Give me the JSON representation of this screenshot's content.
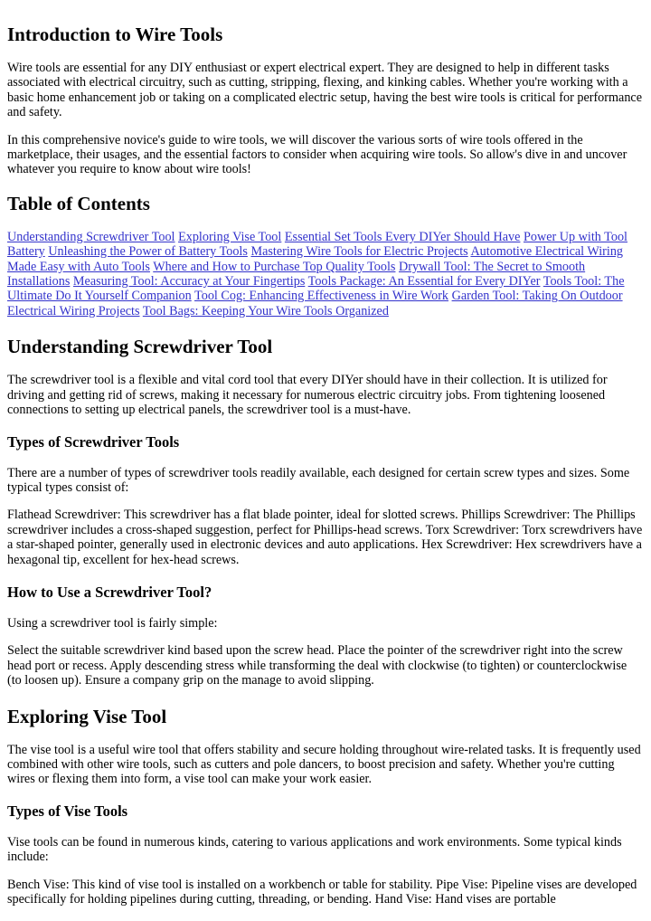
{
  "intro": {
    "heading": "Introduction to Wire Tools",
    "paragraphs": [
      "Wire tools are essential for any DIY enthusiast or expert electrical expert. They are designed to help in different tasks associated with electrical circuitry, such as cutting, stripping, flexing, and kinking cables. Whether you're working with a basic home enhancement job or taking on a complicated electric setup, having the best wire tools is critical for performance and safety.",
      "In this comprehensive novice's guide to wire tools, we will discover the various sorts of wire tools offered in the marketplace, their usages, and the essential factors to consider when acquiring wire tools. So allow's dive in and uncover whatever you require to know about wire tools!"
    ]
  },
  "toc": {
    "heading": "Table of Contents",
    "links": [
      "Understanding Screwdriver Tool",
      "Exploring Vise Tool",
      "Essential Set Tools Every DIYer Should Have",
      "Power Up with Tool Battery",
      "Unleashing the Power of Battery Tools",
      "Mastering Wire Tools for Electric Projects",
      "Automotive Electrical Wiring Made Easy with Auto Tools",
      "Where and How to Purchase Top Quality Tools",
      "Drywall Tool: The Secret to Smooth Installations",
      "Measuring Tool: Accuracy at Your Fingertips",
      "Tools Package: An Essential for Every DIYer",
      "Tools Tool: The Ultimate Do It Yourself Companion",
      "Tool Cog: Enhancing Effectiveness in Wire Work",
      "Garden Tool: Taking On Outdoor Electrical Wiring Projects",
      "Tool Bags: Keeping Your Wire Tools Organized"
    ]
  },
  "screwdriver": {
    "heading": "Understanding Screwdriver Tool",
    "paragraph": "The screwdriver tool is a flexible and vital cord tool that every DIYer should have in their collection. It is utilized for driving and getting rid of screws, making it necessary for numerous electric circuitry jobs. From tightening loosened connections to setting up electrical panels, the screwdriver tool is a must-have.",
    "types": {
      "heading": "Types of Screwdriver Tools",
      "paragraphs": [
        "There are a number of types of screwdriver tools readily available, each designed for certain screw types and sizes. Some typical types consist of:",
        "Flathead Screwdriver: This screwdriver has a flat blade pointer, ideal for slotted screws. Phillips Screwdriver: The Phillips screwdriver includes a cross-shaped suggestion, perfect for Phillips-head screws. Torx Screwdriver: Torx screwdrivers have a star-shaped pointer, generally used in electronic devices and auto applications. Hex Screwdriver: Hex screwdrivers have a hexagonal tip, excellent for hex-head screws."
      ]
    },
    "usage": {
      "heading": "How to Use a Screwdriver Tool?",
      "paragraphs": [
        "Using a screwdriver tool is fairly simple:",
        "Select the suitable screwdriver kind based upon the screw head. Place the pointer of the screwdriver right into the screw head port or recess. Apply descending stress while transforming the deal with clockwise (to tighten) or counterclockwise (to loosen up). Ensure a company grip on the manage to avoid slipping."
      ]
    }
  },
  "vise": {
    "heading": "Exploring Vise Tool",
    "paragraph": "The vise tool is a useful wire tool that offers stability and secure holding throughout wire-related tasks. It is frequently used combined with other wire tools, such as cutters and pole dancers, to boost precision and safety. Whether you're cutting wires or flexing them into form, a vise tool can make your work easier.",
    "types": {
      "heading": "Types of Vise Tools",
      "paragraphs": [
        "Vise tools can be found in numerous kinds, catering to various applications and work environments. Some typical kinds include:",
        "Bench Vise: This kind of vise tool is installed on a workbench or table for stability. Pipe Vise: Pipeline vises are developed specifically for holding pipelines during cutting, threading, or bending. Hand Vise: Hand vises are portable"
      ]
    }
  },
  "colors": {
    "link": "#3333cc",
    "text": "#000000",
    "background": "#ffffff"
  }
}
